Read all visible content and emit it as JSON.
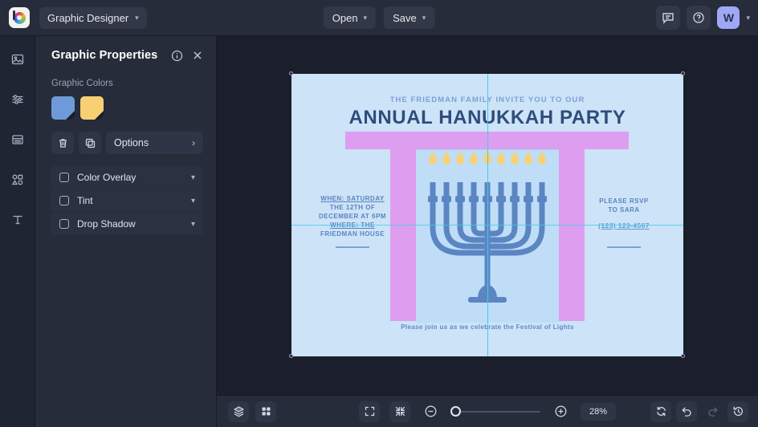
{
  "topbar": {
    "logo_icon": "brand-color-wheel-icon",
    "document_name": "Graphic Designer",
    "open_label": "Open",
    "save_label": "Save",
    "comment_icon": "comment-icon",
    "help_icon": "help-circle-icon",
    "avatar_initial": "W",
    "account_caret": "chevron-down-icon"
  },
  "rail": {
    "items": [
      {
        "icon": "image-icon",
        "name": "rail-item-image"
      },
      {
        "icon": "adjustments-icon",
        "name": "rail-item-adjust"
      },
      {
        "icon": "layout-icon",
        "name": "rail-item-layout"
      },
      {
        "icon": "shapes-icon",
        "name": "rail-item-shapes"
      },
      {
        "icon": "text-icon",
        "name": "rail-item-text"
      }
    ]
  },
  "panel": {
    "title": "Graphic Properties",
    "info_icon": "info-circle-icon",
    "close_icon": "close-icon",
    "section_label": "Graphic Colors",
    "swatches": [
      {
        "name": "swatch-blue",
        "color": "#6e9bd8"
      },
      {
        "name": "swatch-yellow",
        "color": "#f6d073"
      }
    ],
    "delete_icon": "trash-icon",
    "duplicate_icon": "duplicate-icon",
    "options_label": "Options",
    "options_chevron": "chevron-right-icon",
    "effects": [
      {
        "label": "Color Overlay",
        "checked": false
      },
      {
        "label": "Tint",
        "checked": false
      },
      {
        "label": "Drop Shadow",
        "checked": false
      }
    ]
  },
  "canvas": {
    "background_color": "#cde3f8",
    "accent_purple": "#dd9ef0",
    "guide_color": "#49c9e8",
    "artwork": {
      "kicker": "THE FRIEDMAN FAMILY INVITE YOU TO OUR",
      "headline": "ANNUAL HANUKKAH PARTY",
      "left_text_line1": "WHEN: SATURDAY",
      "left_text_line2": "THE 12TH OF",
      "left_text_line3": "DECEMBER AT 6PM",
      "left_text_line4": "WHERE: THE",
      "left_text_line5": "FRIEDMAN HOUSE",
      "right_text_line1": "PLEASE RSVP",
      "right_text_line2": "TO SARA",
      "phone": "(123) 123-4567",
      "tagline": "Please join us as we celebrate the Festival of Lights",
      "menorah_icon": "menorah-icon"
    }
  },
  "bottombar": {
    "layers_icon": "layers-icon",
    "grid_icon": "grid-icon",
    "fit_icon": "fit-to-screen-icon",
    "collapse_icon": "collapse-icon",
    "zoom_out_icon": "zoom-out-icon",
    "zoom_in_icon": "zoom-in-icon",
    "zoom_value": "28%",
    "refresh_icon": "refresh-icon",
    "undo_icon": "undo-icon",
    "redo_icon": "redo-icon",
    "history_icon": "history-icon"
  }
}
